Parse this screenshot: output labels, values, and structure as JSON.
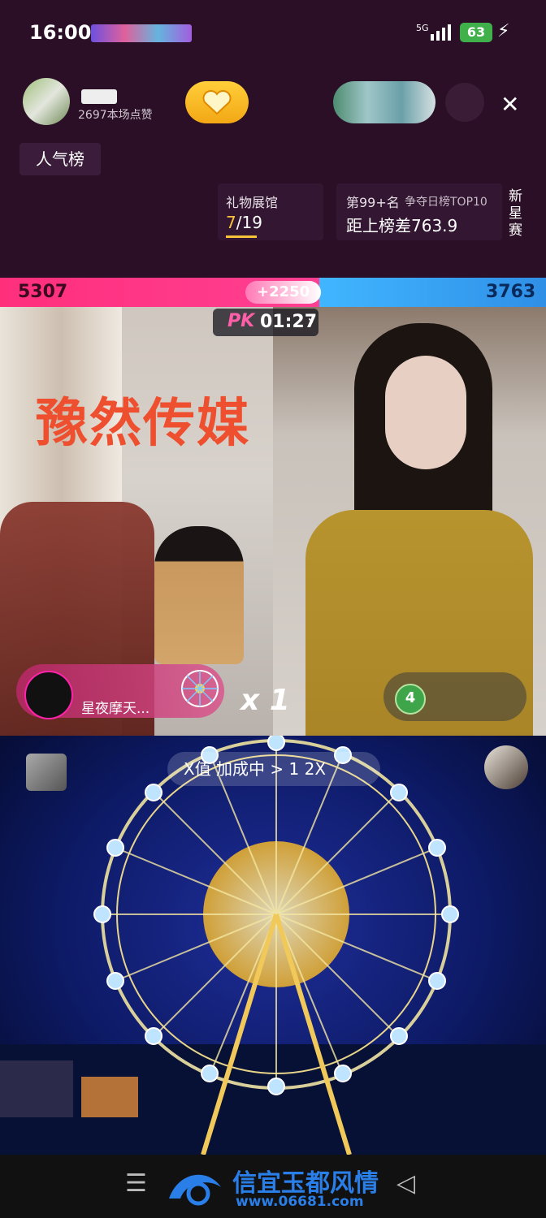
{
  "status_bar": {
    "time": "16:00",
    "network": "5G",
    "battery": "63"
  },
  "header": {
    "likes_text": "2697本场点赞",
    "rank_chip": "人气榜",
    "gift_gallery": {
      "title": "礼物展馆",
      "current": "7",
      "total": "/19"
    },
    "daily_rank": {
      "rank": "第99+名",
      "contest": "争夺日榜TOP10",
      "gap": "距上榜差763.9"
    },
    "new_star": "新星赛"
  },
  "pk": {
    "left_score": "5307",
    "right_score": "3763",
    "bonus": "+2250",
    "logo": "PK",
    "timer": "01:27",
    "left_share": 0.585
  },
  "video": {
    "watermark": "豫然传媒",
    "gift_text": "星夜摩天...",
    "combo": "x 1",
    "user_level": "4"
  },
  "lower": {
    "notice": "X值 加成中 > 1 2X"
  },
  "nav": {
    "site_title": "信宜玉都风情",
    "site_url": "www.06681.com"
  },
  "colors": {
    "pk_red": "#ff2f7c",
    "pk_blue": "#41b6ff",
    "watermark": "#ee4f2f"
  }
}
